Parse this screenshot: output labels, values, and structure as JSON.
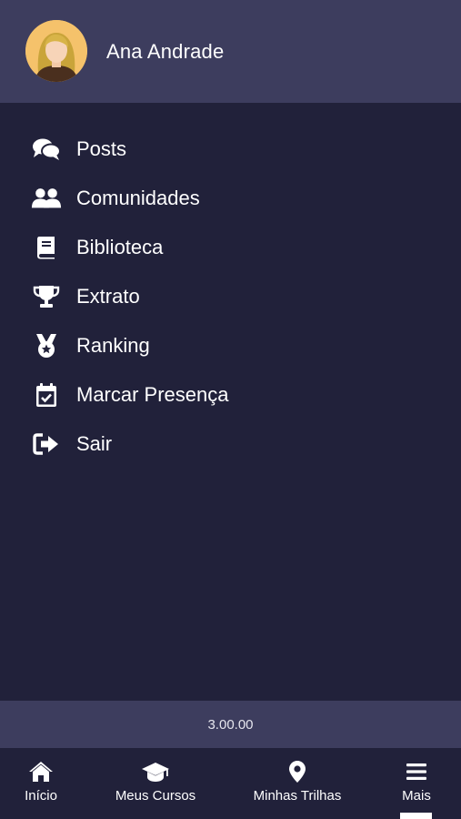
{
  "user": {
    "name": "Ana Andrade"
  },
  "menu": {
    "items": [
      {
        "label": "Posts",
        "icon": "comments-icon"
      },
      {
        "label": "Comunidades",
        "icon": "users-icon"
      },
      {
        "label": "Biblioteca",
        "icon": "book-icon"
      },
      {
        "label": "Extrato",
        "icon": "trophy-icon"
      },
      {
        "label": "Ranking",
        "icon": "medal-icon"
      },
      {
        "label": "Marcar Presença",
        "icon": "calendar-check-icon"
      },
      {
        "label": "Sair",
        "icon": "sign-out-icon"
      }
    ]
  },
  "version": "3.00.00",
  "bottom_nav": {
    "items": [
      {
        "label": "Início",
        "icon": "home-icon"
      },
      {
        "label": "Meus Cursos",
        "icon": "graduation-cap-icon"
      },
      {
        "label": "Minhas Trilhas",
        "icon": "map-marker-icon"
      },
      {
        "label": "Mais",
        "icon": "menu-icon",
        "active": true
      }
    ]
  },
  "colors": {
    "header_bg": "#3d3d5e",
    "body_bg": "#21213a",
    "text": "#ffffff",
    "avatar_bg": "#f5c26b"
  }
}
